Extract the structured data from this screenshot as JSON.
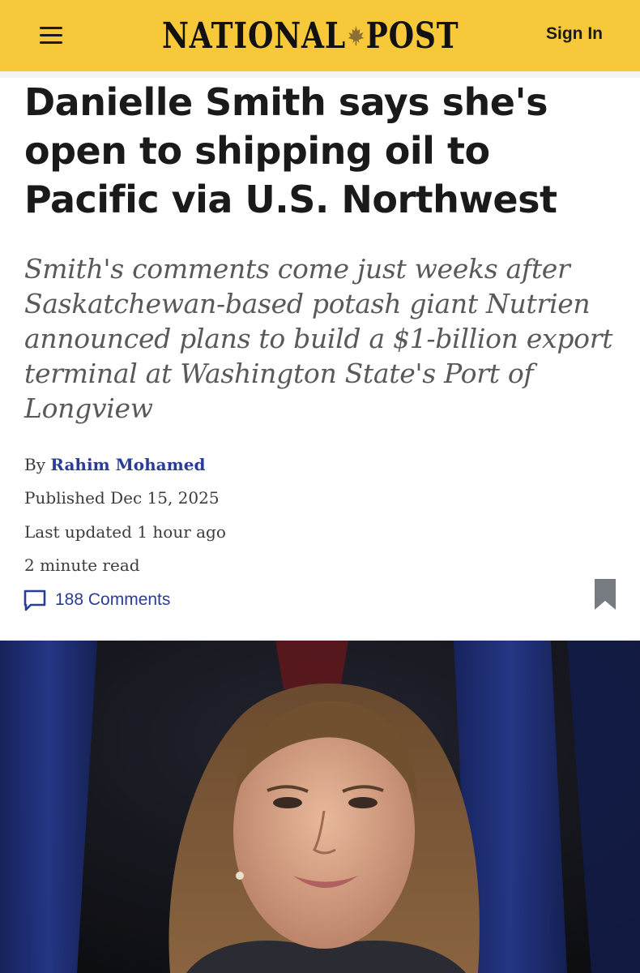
{
  "header": {
    "brand_left": "NATIONAL",
    "brand_right": "POST",
    "sign_in": "Sign In"
  },
  "article": {
    "headline": "Danielle Smith says she's open to shipping oil to Pacific via U.S. Northwest",
    "deck": "Smith's comments come just weeks after Saskatchewan-based potash giant Nutrien announced plans to build a $1-billion export terminal at Washington State's Port of Longview",
    "by_prefix": "By",
    "author": "Rahim Mohamed",
    "published_label": "Published",
    "published_date": "Dec 15, 2025",
    "updated_label": "Last updated",
    "updated_value": "1 hour ago",
    "read_time": "2 minute read",
    "comments": "188 Comments"
  },
  "colors": {
    "header_bg": "#f6c83a",
    "link": "#2a3d96",
    "deck_text": "#595959"
  },
  "icons": {
    "menu": "hamburger-menu-icon",
    "brand_leaf": "maple-leaf-icon",
    "comments": "speech-bubble-icon",
    "bookmark": "bookmark-icon"
  }
}
